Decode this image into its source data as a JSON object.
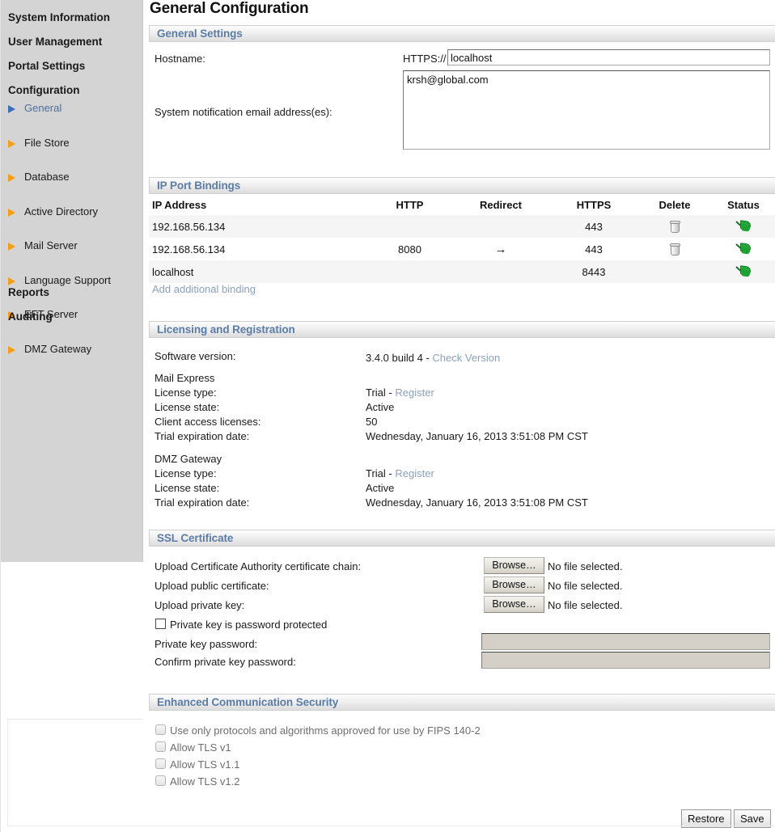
{
  "page": {
    "title": "General Configuration"
  },
  "sidebar": {
    "top_items": [
      {
        "label": "System Information"
      },
      {
        "label": "User Management"
      },
      {
        "label": "Portal Settings"
      },
      {
        "label": "Configuration"
      }
    ],
    "config_items": [
      {
        "label": "General",
        "icon": "triangle-right-icon",
        "active": true,
        "color": "#3b6fb6"
      },
      {
        "label": "File Store",
        "icon": "triangle-right-icon",
        "active": false,
        "color": "#f59e16"
      },
      {
        "label": "Database",
        "icon": "triangle-right-icon",
        "active": false,
        "color": "#f59e16"
      },
      {
        "label": "Active Directory",
        "icon": "triangle-right-icon",
        "active": false,
        "color": "#f59e16"
      },
      {
        "label": "Mail Server",
        "icon": "triangle-right-icon",
        "active": false,
        "color": "#f59e16"
      },
      {
        "label": "Language Support",
        "icon": "triangle-right-icon",
        "active": false,
        "color": "#f59e16"
      },
      {
        "label": "EFT Server",
        "icon": "triangle-right-icon",
        "active": false,
        "color": "#f59e16"
      },
      {
        "label": "DMZ Gateway",
        "icon": "triangle-right-icon",
        "active": false,
        "color": "#f59e16"
      }
    ],
    "bottom_items": [
      {
        "label": "Reports"
      },
      {
        "label": "Auditing"
      }
    ]
  },
  "general_settings": {
    "header": "General Settings",
    "hostname_label": "Hostname:",
    "hostname_protocol": "HTTPS://",
    "hostname_value": "localhost",
    "email_label": "System notification email address(es):",
    "email_value": "krsh@global.com"
  },
  "port_bindings": {
    "header": "IP Port Bindings",
    "columns": [
      "IP Address",
      "HTTP",
      "Redirect",
      "HTTPS",
      "Delete",
      "Status"
    ],
    "rows": [
      {
        "ip": "192.168.56.134",
        "http": "",
        "redirect": "",
        "https": "443",
        "delete": "trash-icon",
        "status": "green-flag-icon"
      },
      {
        "ip": "192.168.56.134",
        "http": "8080",
        "redirect": "→",
        "https": "443",
        "delete": "trash-icon",
        "status": "green-flag-icon"
      },
      {
        "ip": "localhost",
        "http": "",
        "redirect": "",
        "https": "8443",
        "delete": "",
        "status": "green-flag-icon"
      }
    ],
    "add_link": "Add additional binding"
  },
  "licensing": {
    "header": "Licensing and Registration",
    "software_version_label": "Software version:",
    "software_version_value": "3.4.0 build 4",
    "software_version_sep": " - ",
    "check_version_link": "Check Version",
    "products": [
      {
        "name": "Mail Express",
        "fields": [
          {
            "label": "License type:",
            "value": "Trial",
            "sep": " - ",
            "link": "Register"
          },
          {
            "label": "License state:",
            "value": "Active"
          },
          {
            "label": "Client access licenses:",
            "value": "50"
          },
          {
            "label": "Trial expiration date:",
            "value": "Wednesday, January 16, 2013 3:51:08 PM CST"
          }
        ]
      },
      {
        "name": "DMZ Gateway",
        "fields": [
          {
            "label": "License type:",
            "value": "Trial",
            "sep": " - ",
            "link": "Register"
          },
          {
            "label": "License state:",
            "value": "Active"
          },
          {
            "label": "Trial expiration date:",
            "value": "Wednesday, January 16, 2013 3:51:08 PM CST"
          }
        ]
      }
    ]
  },
  "ssl_certificate": {
    "header": "SSL Certificate",
    "uploads": [
      {
        "label": "Upload Certificate Authority certificate chain:",
        "button": "Browse…",
        "status": "No file selected."
      },
      {
        "label": "Upload public certificate:",
        "button": "Browse…",
        "status": "No file selected."
      },
      {
        "label": "Upload private key:",
        "button": "Browse…",
        "status": "No file selected."
      }
    ],
    "pwd_protected_checkbox": "Private key is password protected",
    "pwd_protected_checked": false,
    "private_key_password_label": "Private key password:",
    "private_key_password_value": "",
    "confirm_password_label": "Confirm private key password:",
    "confirm_password_value": ""
  },
  "enhanced_security": {
    "header": "Enhanced Communication Security",
    "options": [
      {
        "label": "Use only protocols and algorithms approved for use by FIPS 140-2",
        "checked": false,
        "disabled": true
      },
      {
        "label": "Allow TLS v1",
        "checked": false,
        "disabled": true
      },
      {
        "label": "Allow TLS v1.1",
        "checked": false,
        "disabled": true
      },
      {
        "label": "Allow TLS v1.2",
        "checked": false,
        "disabled": true
      }
    ]
  },
  "footer": {
    "restore_label": "Restore",
    "save_label": "Save"
  },
  "colors": {
    "section_header_text": "#5b7ca6",
    "link": "#8ba0bd",
    "active_nav": "#4a6f9e",
    "nav_arrow": "#f59e16",
    "status_ok": "#25a83a",
    "sidebar_bg": "#d4d4d4"
  }
}
